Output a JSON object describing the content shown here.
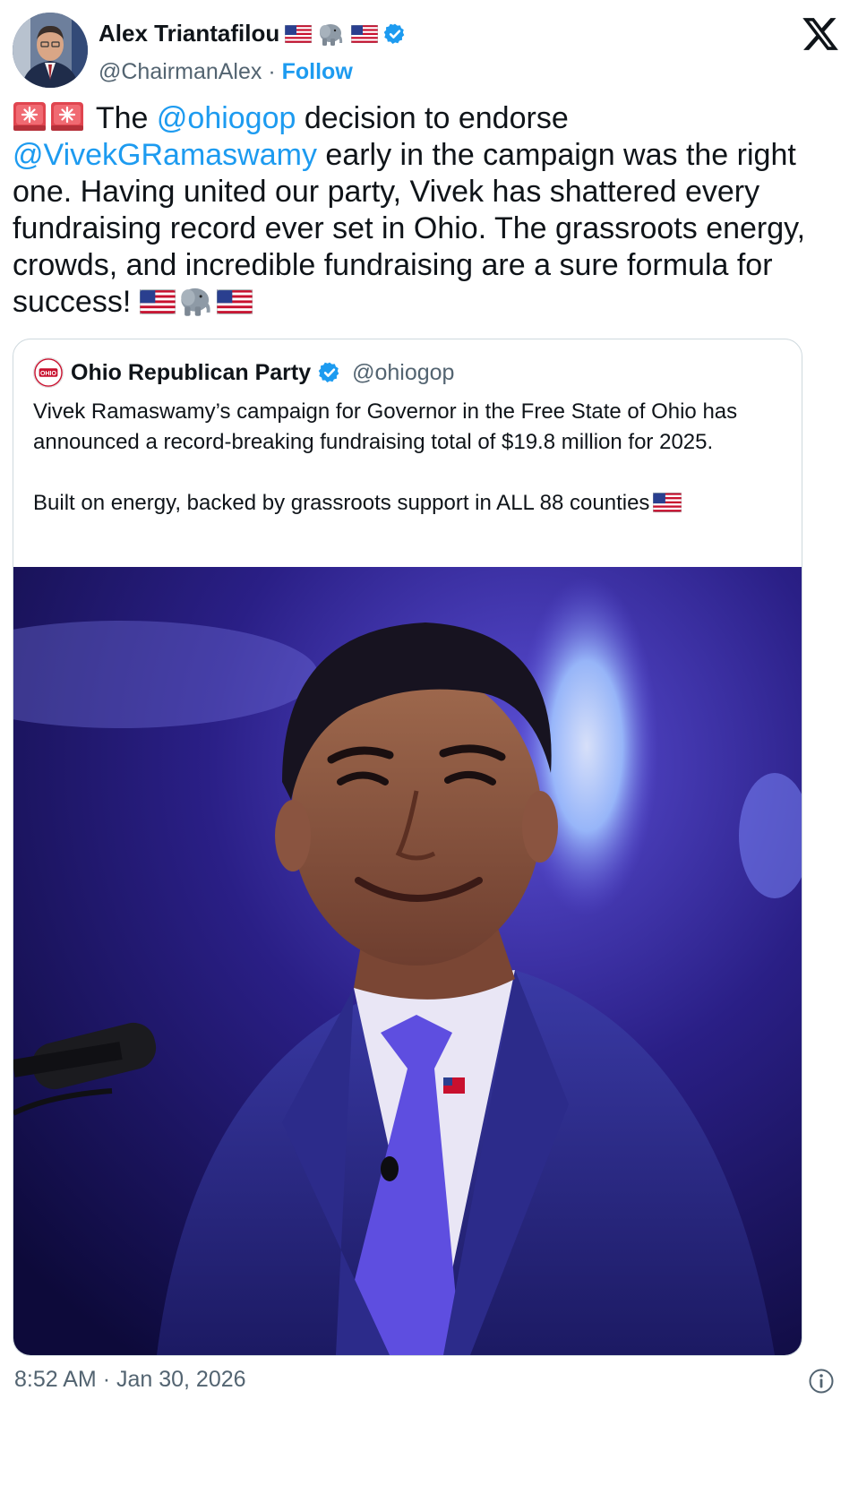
{
  "author": {
    "name": "Alex Triantafilou",
    "handle": "@ChairmanAlex",
    "separator": "·",
    "follow_label": "Follow",
    "name_emoji": [
      "us-flag-icon",
      "elephant-icon",
      "us-flag-icon"
    ]
  },
  "tweet": {
    "leading_emoji": [
      "siren-icon",
      "siren-icon"
    ],
    "text_1": "The ",
    "mention_1": "@ohiogop",
    "text_2": " decision to endorse ",
    "mention_2": "@VivekGRamaswamy",
    "text_3": " early in the campaign was the right one. Having united our party, Vivek has shattered every fundraising record ever set in Ohio. The grassroots energy, crowds, and incredible fundraising are a sure formula for success! ",
    "trailing_emoji": [
      "us-flag-icon",
      "elephant-icon",
      "us-flag-icon"
    ]
  },
  "quoted": {
    "name": "Ohio Republican Party",
    "handle": "@ohiogop",
    "logo_text": "OHIO",
    "paragraph_1": "Vivek Ramaswamy’s campaign for Governor in the Free State of Ohio has announced a record-breaking fundraising total of $19.8 million for 2025.",
    "paragraph_2": "Built on energy, backed by grassroots support in ALL 88 counties",
    "paragraph_2_emoji": "us-flag-icon"
  },
  "footer": {
    "time": "8:52 AM",
    "separator": "·",
    "date": "Jan 30, 2026"
  },
  "colors": {
    "link": "#1d9bf0",
    "muted": "#536471",
    "text": "#0f1419",
    "border": "#cfd9de"
  }
}
